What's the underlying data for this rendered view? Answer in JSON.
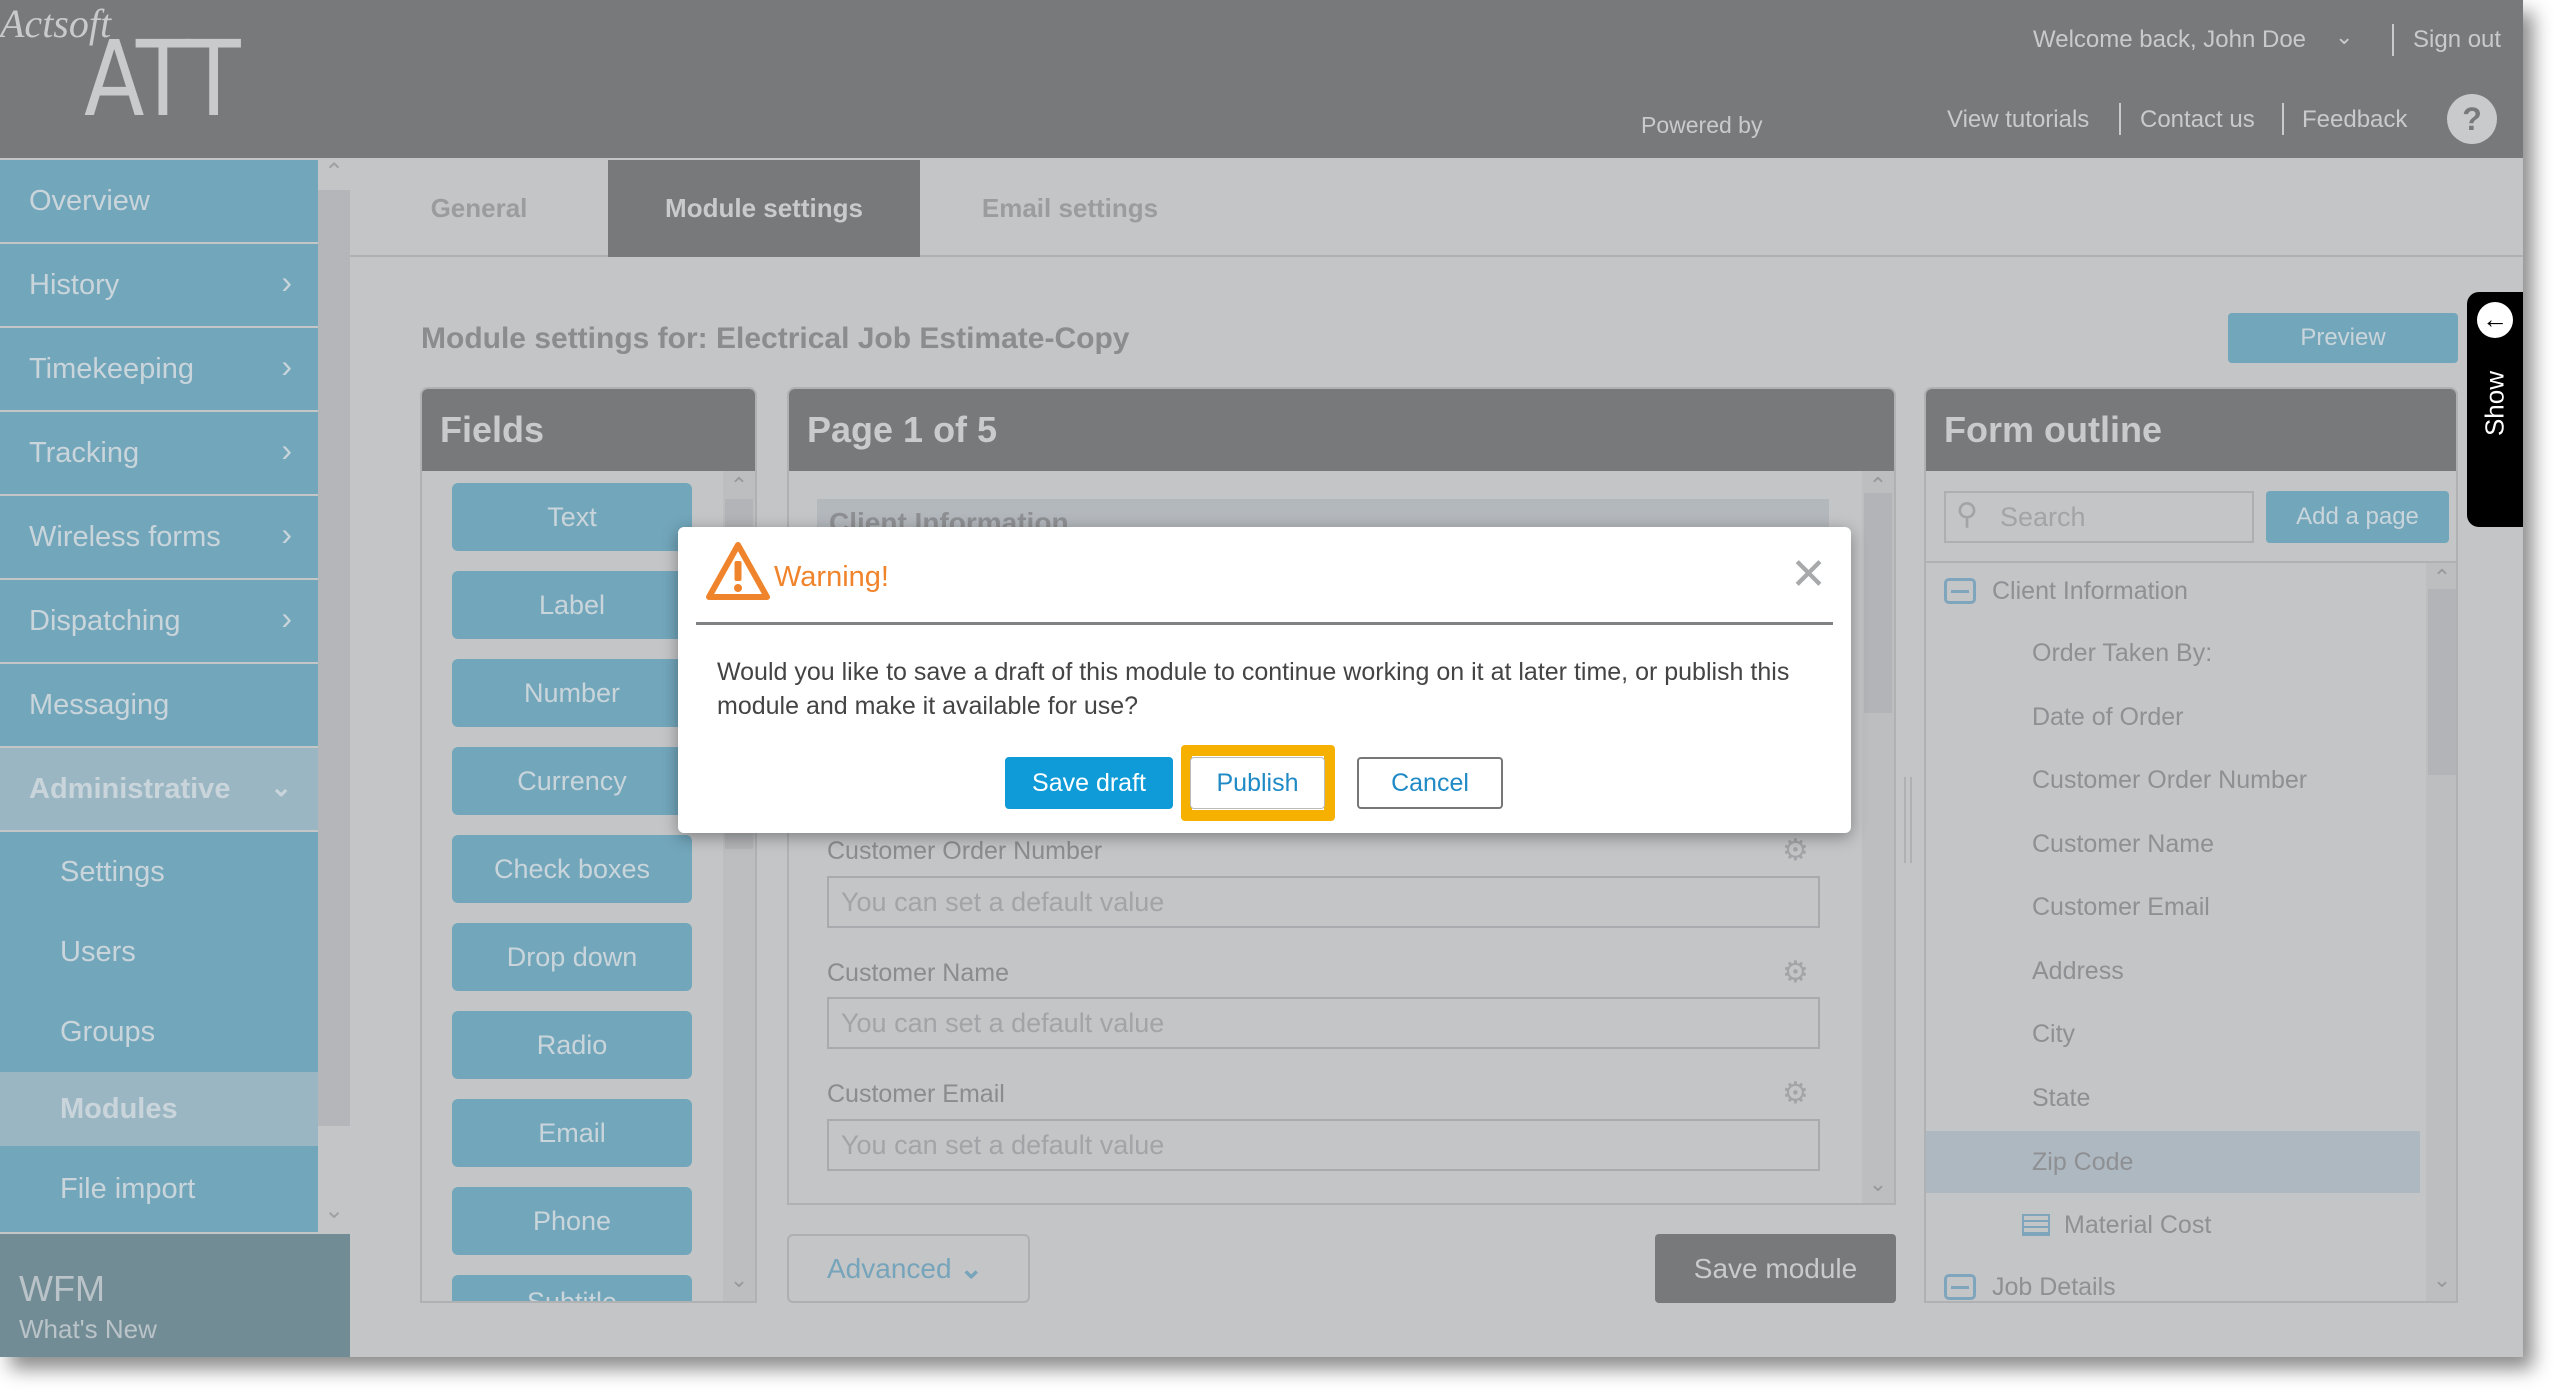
{
  "header": {
    "logo": "ATT",
    "welcome": "Welcome back, John Doe",
    "sign_out": "Sign out",
    "powered_by": "Powered by",
    "brand": "Actsoft",
    "links": [
      "View tutorials",
      "Contact us",
      "Feedback"
    ],
    "help": "?"
  },
  "sidebar": {
    "items": [
      {
        "label": "Overview",
        "has_children": false
      },
      {
        "label": "History",
        "has_children": true
      },
      {
        "label": "Timekeeping",
        "has_children": true
      },
      {
        "label": "Tracking",
        "has_children": true
      },
      {
        "label": "Wireless forms",
        "has_children": true
      },
      {
        "label": "Dispatching",
        "has_children": true
      },
      {
        "label": "Messaging",
        "has_children": false
      },
      {
        "label": "Administrative",
        "expanded": true
      }
    ],
    "sub_items": [
      "Settings",
      "Users",
      "Groups",
      "Modules",
      "File import"
    ],
    "active_sub_item": "Modules",
    "footer_title": "WFM",
    "footer_sub": "What's New"
  },
  "tabs": [
    {
      "label": "General",
      "active": false
    },
    {
      "label": "Module settings",
      "active": true
    },
    {
      "label": "Email settings",
      "active": false
    }
  ],
  "main": {
    "title": "Module settings for: Electrical Job Estimate-Copy",
    "preview_label": "Preview",
    "advanced_label": "Advanced",
    "save_module_label": "Save module"
  },
  "fields_panel": {
    "title": "Fields",
    "buttons": [
      "Text",
      "Label",
      "Number",
      "Currency",
      "Check boxes",
      "Drop down",
      "Radio",
      "Email",
      "Phone",
      "Subtitle"
    ]
  },
  "page_panel": {
    "title": "Page 1 of 5",
    "section": "Client Information",
    "fields": [
      {
        "label": "Customer Order Number",
        "placeholder": "You can set a default value"
      },
      {
        "label": "Customer Name",
        "placeholder": "You can set a default value"
      },
      {
        "label": "Customer Email",
        "placeholder": "You can set a default value"
      }
    ]
  },
  "outline_panel": {
    "title": "Form outline",
    "search_placeholder": "Search",
    "add_page_label": "Add a page",
    "groups": [
      {
        "label": "Client Information",
        "items": [
          "Order Taken By:",
          "Date of Order",
          "Customer Order Number",
          "Customer Name",
          "Customer Email",
          "Address",
          "City",
          "State",
          "Zip Code",
          "Material Cost"
        ],
        "selected": "Zip Code",
        "table_item": "Material Cost"
      },
      {
        "label": "Job Details"
      }
    ]
  },
  "show_tab": {
    "label": "Show"
  },
  "dialog": {
    "title": "Warning!",
    "message": "Would you like to save a draft of this module to continue working on it at later time, or publish this module and make it available for use?",
    "buttons": {
      "save_draft": "Save draft",
      "publish": "Publish",
      "cancel": "Cancel"
    },
    "highlighted_button": "Publish",
    "close": "✕"
  },
  "colors": {
    "header": "#78797b",
    "nav": "#72a6bb",
    "warning": "#f0842c",
    "primary": "#0f9bd7",
    "highlight": "#f6b100"
  }
}
